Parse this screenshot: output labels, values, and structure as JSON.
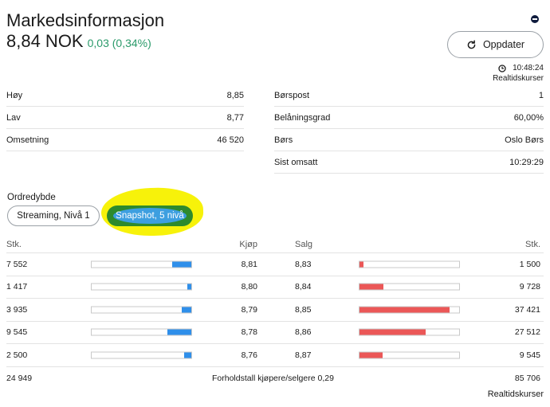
{
  "header": {
    "title": "Markedsinformasjon",
    "price": "8,84 NOK",
    "change": "0,03 (0,34%)",
    "change_color": "#2a9a6a"
  },
  "toolbar": {
    "refresh_label": "Oppdater",
    "refresh_icon": "refresh-icon",
    "minimize_icon": "minus-circle-icon"
  },
  "status": {
    "time": "10:48:24",
    "time_icon": "clock-icon",
    "realtime_label": "Realtidskurser"
  },
  "info_left": [
    {
      "label": "Høy",
      "value": "8,85"
    },
    {
      "label": "Lav",
      "value": "8,77"
    },
    {
      "label": "Omsetning",
      "value": "46 520"
    }
  ],
  "info_right": [
    {
      "label": "Børspost",
      "value": "1"
    },
    {
      "label": "Belåningsgrad",
      "value": "60,00%"
    },
    {
      "label": "Børs",
      "value": "Oslo Børs"
    },
    {
      "label": "Sist omsatt",
      "value": "10:29:29"
    }
  ],
  "depth": {
    "label": "Ordredybde",
    "options": [
      "Streaming, Nivå 1",
      "Snapshot, 5 nivå"
    ],
    "selected": "Snapshot, 5 nivå"
  },
  "orderbook": {
    "headers": {
      "buy_qty": "Stk.",
      "bid": "Kjøp",
      "ask": "Salg",
      "sell_qty": "Stk."
    },
    "rows": [
      {
        "buy_qty": "7 552",
        "bid": "8,81",
        "ask": "8,83",
        "sell_qty": "1 500",
        "buy_fill": 0.19,
        "sell_fill": 0.04
      },
      {
        "buy_qty": "1 417",
        "bid": "8,80",
        "ask": "8,84",
        "sell_qty": "9 728",
        "buy_fill": 0.04,
        "sell_fill": 0.24
      },
      {
        "buy_qty": "3 935",
        "bid": "8,79",
        "ask": "8,85",
        "sell_qty": "37 421",
        "buy_fill": 0.1,
        "sell_fill": 0.9
      },
      {
        "buy_qty": "9 545",
        "bid": "8,78",
        "ask": "8,86",
        "sell_qty": "27 512",
        "buy_fill": 0.24,
        "sell_fill": 0.66
      },
      {
        "buy_qty": "2 500",
        "bid": "8,76",
        "ask": "8,87",
        "sell_qty": "9 545",
        "buy_fill": 0.07,
        "sell_fill": 0.23
      }
    ],
    "total_buy": "24 949",
    "ratio_text": "Forholdstall kjøpere/selgere 0,29",
    "total_sell": "85 706"
  },
  "footer": {
    "realtime_label": "Realtidskurser"
  }
}
